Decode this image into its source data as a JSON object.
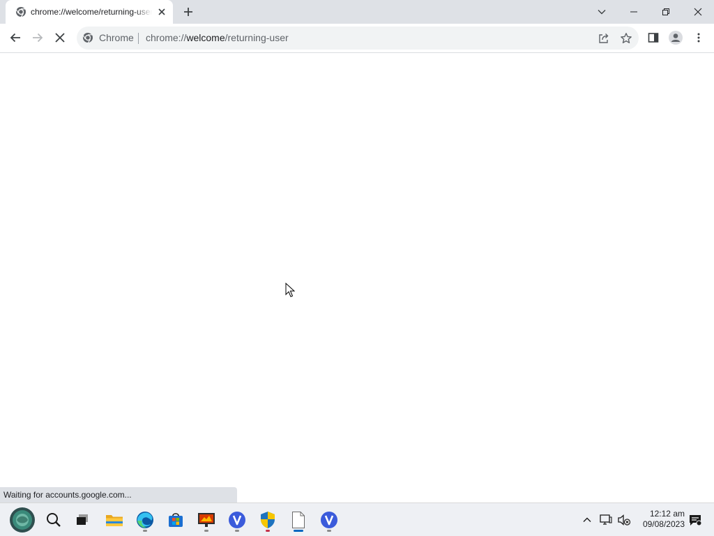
{
  "browser": {
    "tab": {
      "title": "chrome://welcome/returning-user",
      "favicon": "chrome-icon"
    },
    "window_controls": [
      "chevron-down-icon",
      "minimize-icon",
      "restore-icon",
      "close-icon"
    ],
    "omnibox": {
      "chip_label": "Chrome",
      "url_scheme": "chrome://",
      "url_host": "welcome",
      "url_path": "/returning-user"
    },
    "status_text": "Waiting for accounts.google.com..."
  },
  "taskbar": {
    "apps": [
      {
        "name": "start-button",
        "icon": "start-orb-icon",
        "running": false
      },
      {
        "name": "search-button",
        "icon": "search-icon",
        "running": false
      },
      {
        "name": "task-view-button",
        "icon": "task-view-icon",
        "running": false
      },
      {
        "name": "file-explorer",
        "icon": "folder-icon",
        "running": false
      },
      {
        "name": "edge",
        "icon": "edge-icon",
        "running": true
      },
      {
        "name": "store",
        "icon": "store-icon",
        "running": false
      },
      {
        "name": "presentation-app",
        "icon": "presentation-icon",
        "running": true
      },
      {
        "name": "v-app-1",
        "icon": "v-circle-icon",
        "running": true
      },
      {
        "name": "security-app",
        "icon": "shield-icon",
        "running": true
      },
      {
        "name": "blank-document",
        "icon": "document-icon",
        "running": true,
        "active": true
      },
      {
        "name": "v-app-2",
        "icon": "v-circle-icon",
        "running": true
      }
    ],
    "clock": {
      "time": "12:12 am",
      "date": "09/08/2023"
    }
  },
  "colors": {
    "tabstrip": "#dee1e6",
    "omnibox": "#f1f3f4",
    "taskbar": "#eef0f4",
    "accent": "#0067c0",
    "v_app": "#3b5bdb"
  }
}
